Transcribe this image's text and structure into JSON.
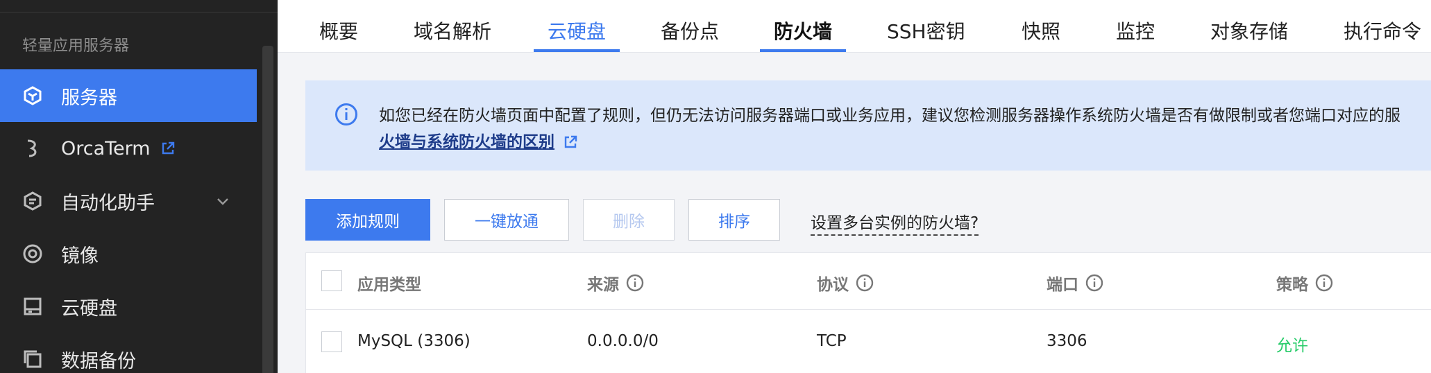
{
  "sidebar": {
    "section_title": "轻量应用服务器",
    "items": [
      {
        "label": "服务器",
        "icon": "server-cube-icon",
        "active": true
      },
      {
        "label": "OrcaTerm",
        "icon": "orcaterm-icon",
        "external": true
      },
      {
        "label": "自动化助手",
        "icon": "automation-icon",
        "expandable": true
      },
      {
        "label": "镜像",
        "icon": "image-disc-icon"
      },
      {
        "label": "云硬盘",
        "icon": "cloud-disk-icon"
      },
      {
        "label": "数据备份",
        "icon": "backup-icon"
      }
    ]
  },
  "tabs": [
    {
      "label": "概要"
    },
    {
      "label": "域名解析"
    },
    {
      "label": "云硬盘",
      "state": "hover"
    },
    {
      "label": "备份点"
    },
    {
      "label": "防火墙",
      "state": "active"
    },
    {
      "label": "SSH密钥"
    },
    {
      "label": "快照"
    },
    {
      "label": "监控"
    },
    {
      "label": "对象存储"
    },
    {
      "label": "执行命令"
    }
  ],
  "notice": {
    "text": "如您已经在防火墙页面中配置了规则，但仍无法访问服务器端口或业务应用，建议您检测服务器操作系统防火墙是否有做限制或者您端口对应的服",
    "link": "火墙与系统防火墙的区别"
  },
  "toolbar": {
    "add_rule": "添加规则",
    "one_click_open": "一键放通",
    "delete": "删除",
    "sort": "排序",
    "multi_instance_link": "设置多台实例的防火墙?"
  },
  "table": {
    "columns": [
      "应用类型",
      "来源",
      "协议",
      "端口",
      "策略"
    ],
    "rows": [
      {
        "app_type": "MySQL (3306)",
        "source": "0.0.0.0/0",
        "protocol": "TCP",
        "port": "3306",
        "policy": "允许"
      }
    ]
  },
  "colors": {
    "accent": "#3d7aee",
    "sidebar_bg": "#232323",
    "notice_bg": "#dbe7fb",
    "allow_green": "#29cc6a"
  }
}
